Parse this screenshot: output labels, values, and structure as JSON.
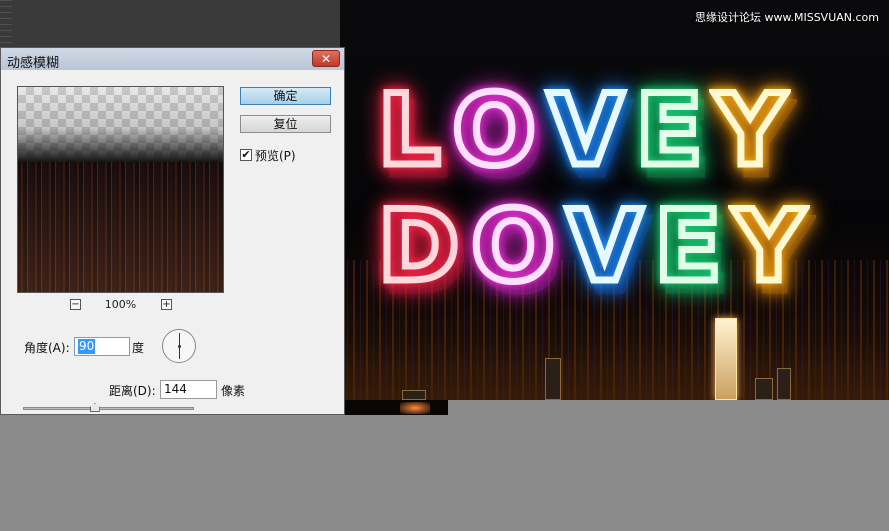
{
  "dialog": {
    "title": "动感模糊",
    "close_label": "✕",
    "ok_label": "确定",
    "reset_label": "复位",
    "preview_label": "预览(P)",
    "preview_checked": true,
    "zoom": {
      "minus": "−",
      "level": "100%",
      "plus": "+"
    },
    "angle": {
      "label": "角度(A):",
      "value": "90",
      "unit": "度"
    },
    "distance": {
      "label": "距离(D):",
      "value": "144",
      "unit": "像素",
      "slider_fraction": 0.42
    }
  },
  "canvas": {
    "watermark": "思缘设计论坛 www.MISSVUAN.com",
    "line1": [
      "L",
      "O",
      "V",
      "E",
      "Y"
    ],
    "line2": [
      "D",
      "O",
      "V",
      "E",
      "Y"
    ],
    "colors": {
      "red": "#ff2a48",
      "pink": "#e040d0",
      "blue": "#2a8cff",
      "green": "#20d070",
      "yellow": "#ffb020"
    }
  }
}
